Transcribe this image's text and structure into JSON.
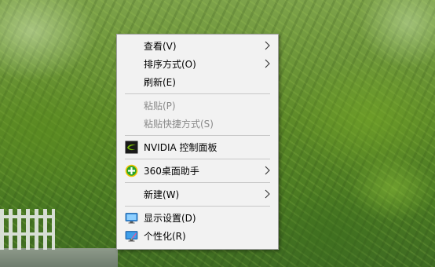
{
  "menu": {
    "items": [
      {
        "label": "查看(V)",
        "has_submenu": true,
        "enabled": true
      },
      {
        "label": "排序方式(O)",
        "has_submenu": true,
        "enabled": true
      },
      {
        "label": "刷新(E)",
        "has_submenu": false,
        "enabled": true
      },
      {
        "label": "粘贴(P)",
        "has_submenu": false,
        "enabled": false
      },
      {
        "label": "粘贴快捷方式(S)",
        "has_submenu": false,
        "enabled": false
      },
      {
        "label": "NVIDIA 控制面板",
        "icon": "nvidia-icon",
        "has_submenu": false,
        "enabled": true
      },
      {
        "label": "360桌面助手",
        "icon": "360-desktop-icon",
        "has_submenu": true,
        "enabled": true
      },
      {
        "label": "新建(W)",
        "has_submenu": true,
        "enabled": true
      },
      {
        "label": "显示设置(D)",
        "icon": "display-settings-icon",
        "has_submenu": false,
        "enabled": true
      },
      {
        "label": "个性化(R)",
        "icon": "personalize-icon",
        "has_submenu": false,
        "enabled": true
      }
    ]
  },
  "colors": {
    "menu_background": "#f2f2f2",
    "menu_border": "#a0a0a0",
    "disabled_text": "#8a8a8a",
    "nvidia_green": "#76b900"
  }
}
